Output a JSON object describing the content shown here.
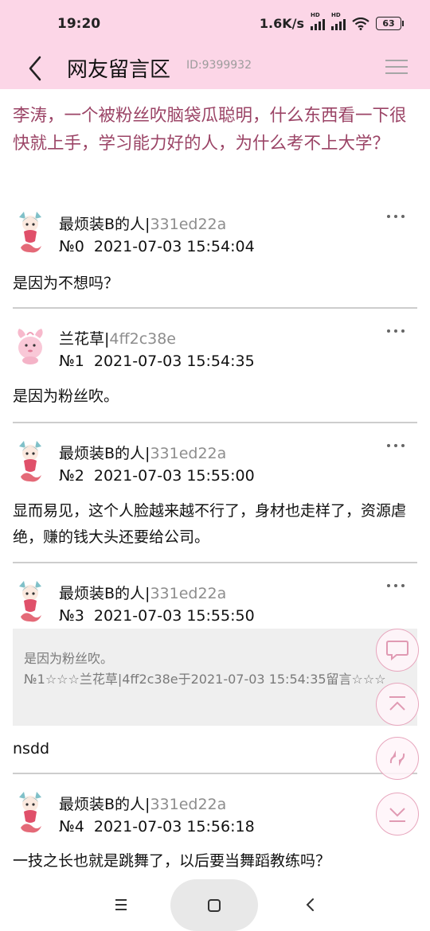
{
  "status_bar": {
    "time": "19:20",
    "network_speed": "1.6K/s",
    "battery_level": "63",
    "icons": [
      "signal-hd-icon",
      "signal-hd-icon",
      "wifi-icon",
      "battery-icon"
    ]
  },
  "header": {
    "title": "网友留言区",
    "post_id": "ID:9399932",
    "back_icon": "chevron-left-icon",
    "menu_icon": "hamburger-menu-icon"
  },
  "question": "李涛，一个被粉丝吹脑袋瓜聪明，什么东西看一下很快就上手，学习能力好的人，为什么考不上大学？",
  "comments": [
    {
      "user": "最烦装B的人",
      "hash": "331ed22a",
      "number": "№0",
      "time": "2021-07-03 15:54:04",
      "text": "是因为不想吗？"
    },
    {
      "user": "兰花草",
      "hash": "4ff2c38e",
      "number": "№1",
      "time": "2021-07-03 15:54:35",
      "text": "是因为粉丝吹。"
    },
    {
      "user": "最烦装B的人",
      "hash": "331ed22a",
      "number": "№2",
      "time": "2021-07-03 15:55:00",
      "text": "显而易见，这个人脸越来越不行了，身材也走样了，资源虐绝，赚的钱大头还要给公司。"
    },
    {
      "user": "最烦装B的人",
      "hash": "331ed22a",
      "number": "№3",
      "time": "2021-07-03 15:55:50",
      "text": "nsdd",
      "quote": {
        "text": "是因为粉丝吹。",
        "ref": "№1☆☆☆兰花草|4ff2c38e于2021-07-03 15:54:35留言☆☆☆"
      }
    },
    {
      "user": "最烦装B的人",
      "hash": "331ed22a",
      "number": "№4",
      "time": "2021-07-03 15:56:18",
      "text": "一技之长也就是跳舞了，以后要当舞蹈教练吗？"
    }
  ],
  "floating_actions": [
    "comment-icon",
    "scroll-top-icon",
    "refresh-icon",
    "scroll-bottom-icon"
  ],
  "nav": [
    "recent-apps-icon",
    "home-icon",
    "back-icon"
  ],
  "colors": {
    "header_bg": "#fcd6e7",
    "question_text": "#9b4466",
    "hash_text": "#8d8d8d",
    "fab_border": "#e7a6bd"
  }
}
